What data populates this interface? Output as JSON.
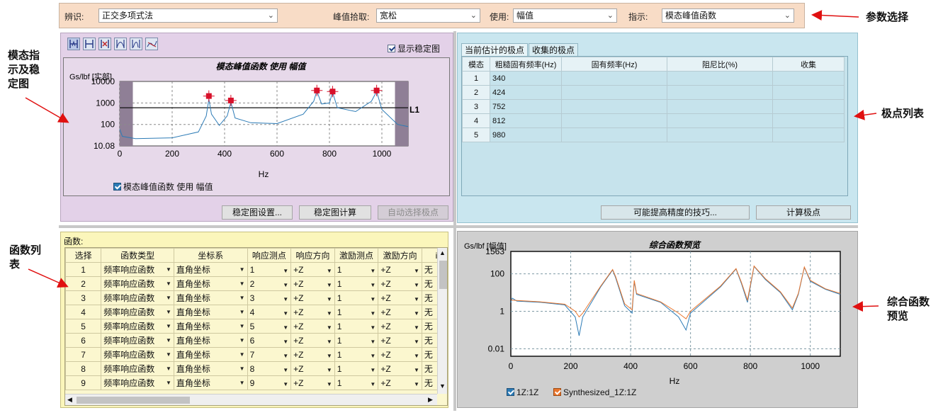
{
  "params": {
    "identify_label": "辨识:",
    "identify_value": "正交多项式法",
    "peak_label": "峰值拾取:",
    "peak_value": "宽松",
    "use_label": "使用:",
    "use_value": "幅值",
    "indicator_label": "指示:",
    "indicator_value": "模态峰值函数"
  },
  "callouts": {
    "param": "参数选择",
    "mode_l1": "模态指",
    "mode_l2": "示及稳",
    "mode_l3": "定图",
    "poles": "极点列表",
    "func_l1": "函数列",
    "func_l2": "表",
    "synth_l1": "综合函数",
    "synth_l2": "预览"
  },
  "mode": {
    "show_stab": "显示稳定图",
    "title": "模态峰值函数 使用 幅值",
    "ylabel": "Gs/lbf [实部]",
    "xlabel": "Hz",
    "line_label": "L1",
    "legend": "模态峰值函数 使用 幅值",
    "btn_stab_settings": "稳定图设置...",
    "btn_stab_calc": "稳定图计算",
    "btn_auto_select": "自动选择极点"
  },
  "poles": {
    "tab_current": "当前估计的极点",
    "tab_collected": "收集的极点",
    "headers": [
      "模态",
      "粗糙固有频率(Hz)",
      "固有频率(Hz)",
      "阻尼比(%)",
      "收集"
    ],
    "rows": [
      {
        "mode": "1",
        "freq": "340"
      },
      {
        "mode": "2",
        "freq": "424"
      },
      {
        "mode": "3",
        "freq": "752"
      },
      {
        "mode": "4",
        "freq": "812"
      },
      {
        "mode": "5",
        "freq": "980"
      }
    ],
    "btn_tips": "可能提高精度的技巧...",
    "btn_calc": "计算极点"
  },
  "funcs": {
    "title": "函数:",
    "headers": [
      "选择",
      "函数类型",
      "坐标系",
      "响应测点",
      "响应方向",
      "激励测点",
      "激励方向",
      "i"
    ],
    "rows": [
      {
        "sel": "1",
        "type": "频率响应函数",
        "coord": "直角坐标",
        "rp": "1",
        "rd": "+Z",
        "ep": "1",
        "ed": "+Z",
        "x": "无"
      },
      {
        "sel": "2",
        "type": "频率响应函数",
        "coord": "直角坐标",
        "rp": "2",
        "rd": "+Z",
        "ep": "1",
        "ed": "+Z",
        "x": "无"
      },
      {
        "sel": "3",
        "type": "频率响应函数",
        "coord": "直角坐标",
        "rp": "3",
        "rd": "+Z",
        "ep": "1",
        "ed": "+Z",
        "x": "无"
      },
      {
        "sel": "4",
        "type": "频率响应函数",
        "coord": "直角坐标",
        "rp": "4",
        "rd": "+Z",
        "ep": "1",
        "ed": "+Z",
        "x": "无"
      },
      {
        "sel": "5",
        "type": "频率响应函数",
        "coord": "直角坐标",
        "rp": "5",
        "rd": "+Z",
        "ep": "1",
        "ed": "+Z",
        "x": "无"
      },
      {
        "sel": "6",
        "type": "频率响应函数",
        "coord": "直角坐标",
        "rp": "6",
        "rd": "+Z",
        "ep": "1",
        "ed": "+Z",
        "x": "无"
      },
      {
        "sel": "7",
        "type": "频率响应函数",
        "coord": "直角坐标",
        "rp": "7",
        "rd": "+Z",
        "ep": "1",
        "ed": "+Z",
        "x": "无"
      },
      {
        "sel": "8",
        "type": "频率响应函数",
        "coord": "直角坐标",
        "rp": "8",
        "rd": "+Z",
        "ep": "1",
        "ed": "+Z",
        "x": "无"
      },
      {
        "sel": "9",
        "type": "频率响应函数",
        "coord": "直角坐标",
        "rp": "9",
        "rd": "+Z",
        "ep": "1",
        "ed": "+Z",
        "x": "无"
      }
    ]
  },
  "synth": {
    "ylabel": "Gs/lbf [幅值]",
    "title": "综合函数预览",
    "xlabel": "Hz",
    "legend_a": "1Z:1Z",
    "legend_b": "Synthesized_1Z:1Z"
  },
  "colors": {
    "series_measured": "#2c7bb6",
    "series_synth": "#e9752c",
    "peak_marker": "#d8102a",
    "arrow": "#e01010"
  },
  "chart_data": [
    {
      "type": "line",
      "title": "模态峰值函数 使用 幅值",
      "xlabel": "Hz",
      "ylabel": "Gs/lbf [实部]",
      "xlim": [
        0,
        1100
      ],
      "ylim": [
        10.08,
        10000
      ],
      "yscale": "log",
      "xticks": [
        "0",
        "200",
        "400",
        "600",
        "800",
        "1000"
      ],
      "yticks": [
        "10.08",
        "100",
        "1000",
        "10000"
      ],
      "series": [
        {
          "name": "模态峰值函数 使用 幅值",
          "x": [
            0,
            10,
            60,
            200,
            300,
            330,
            340,
            350,
            380,
            410,
            424,
            440,
            500,
            600,
            700,
            740,
            752,
            770,
            800,
            812,
            830,
            900,
            960,
            980,
            1000,
            1060,
            1100
          ],
          "y": [
            60,
            28,
            22,
            24,
            45,
            250,
            1500,
            300,
            90,
            250,
            1100,
            200,
            120,
            110,
            300,
            1200,
            3600,
            900,
            1000,
            3200,
            600,
            400,
            1200,
            3400,
            500,
            100,
            80
          ]
        }
      ],
      "peaks": [
        {
          "x": 340,
          "y": 2100
        },
        {
          "x": 424,
          "y": 1300
        },
        {
          "x": 752,
          "y": 3800
        },
        {
          "x": 812,
          "y": 3400
        },
        {
          "x": 980,
          "y": 3800
        }
      ],
      "threshold": 600,
      "threshold_label": "L1"
    },
    {
      "type": "line",
      "title": "综合函数预览",
      "xlabel": "Hz",
      "ylabel": "Gs/lbf [幅值]",
      "xlim": [
        0,
        1100
      ],
      "ylim": [
        0.004,
        1563
      ],
      "yscale": "log",
      "xticks": [
        "0",
        "200",
        "400",
        "600",
        "800",
        "1000"
      ],
      "yticks": [
        "0.01",
        "1",
        "100",
        "1563"
      ],
      "series": [
        {
          "name": "1Z:1Z",
          "x": [
            0,
            5,
            20,
            100,
            180,
            215,
            228,
            240,
            300,
            340,
            350,
            380,
            405,
            412,
            420,
            500,
            560,
            585,
            600,
            700,
            752,
            770,
            790,
            812,
            850,
            900,
            940,
            960,
            980,
            1000,
            1050,
            1100
          ],
          "y": [
            3,
            5,
            3.5,
            3,
            2.2,
            0.5,
            0.05,
            0.5,
            20,
            160,
            60,
            2,
            0.8,
            40,
            8,
            3,
            0.5,
            0.1,
            0.8,
            20,
            180,
            30,
            3,
            250,
            50,
            10,
            1.2,
            8,
            220,
            40,
            15,
            8
          ]
        },
        {
          "name": "Synthesized_1Z:1Z",
          "x": [
            0,
            20,
            100,
            180,
            215,
            228,
            240,
            300,
            340,
            350,
            380,
            405,
            412,
            420,
            500,
            560,
            585,
            600,
            700,
            752,
            770,
            790,
            812,
            850,
            900,
            940,
            960,
            980,
            1000,
            1050,
            1100
          ],
          "y": [
            4,
            3.8,
            3.2,
            2.4,
            1.0,
            0.5,
            0.8,
            22,
            170,
            70,
            2.5,
            1.2,
            45,
            9,
            3.2,
            0.8,
            0.4,
            1.0,
            22,
            190,
            35,
            4,
            260,
            55,
            11,
            1.5,
            9,
            230,
            45,
            16,
            9
          ]
        }
      ]
    }
  ]
}
